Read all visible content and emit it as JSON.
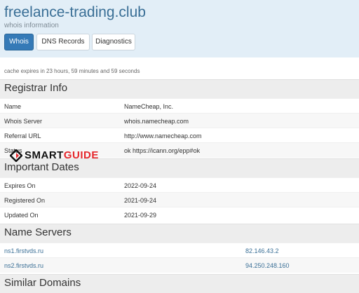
{
  "header": {
    "title": "freelance-trading.club",
    "subtitle": "whois information",
    "tabs": [
      {
        "label": "Whois",
        "active": true
      },
      {
        "label": "DNS Records",
        "active": false
      },
      {
        "label": "Diagnostics",
        "active": false
      }
    ]
  },
  "cache_note": "cache expires in 23 hours, 59 minutes and 59 seconds",
  "registrar": {
    "heading": "Registrar Info",
    "rows": [
      {
        "label": "Name",
        "value": "NameCheap, Inc."
      },
      {
        "label": "Whois Server",
        "value": "whois.namecheap.com"
      },
      {
        "label": "Referral URL",
        "value": "http://www.namecheap.com"
      },
      {
        "label": "Status",
        "value": "ok https://icann.org/epp#ok"
      }
    ]
  },
  "dates": {
    "heading": "Important Dates",
    "rows": [
      {
        "label": "Expires On",
        "value": "2022-09-24"
      },
      {
        "label": "Registered On",
        "value": "2021-09-24"
      },
      {
        "label": "Updated On",
        "value": "2021-09-29"
      }
    ]
  },
  "name_servers": {
    "heading": "Name Servers",
    "rows": [
      {
        "host": "ns1.firstvds.ru",
        "ip": "82.146.43.2"
      },
      {
        "host": "ns2.firstvds.ru",
        "ip": "94.250.248.160"
      }
    ]
  },
  "similar": {
    "heading": "Similar Domains"
  },
  "watermark": {
    "part1": "SMART",
    "part2": "GUIDE"
  },
  "colors": {
    "accent": "#357ab7",
    "header_bg": "#e2eef7",
    "link": "#3a6f96",
    "brand_red": "#e5262b"
  }
}
